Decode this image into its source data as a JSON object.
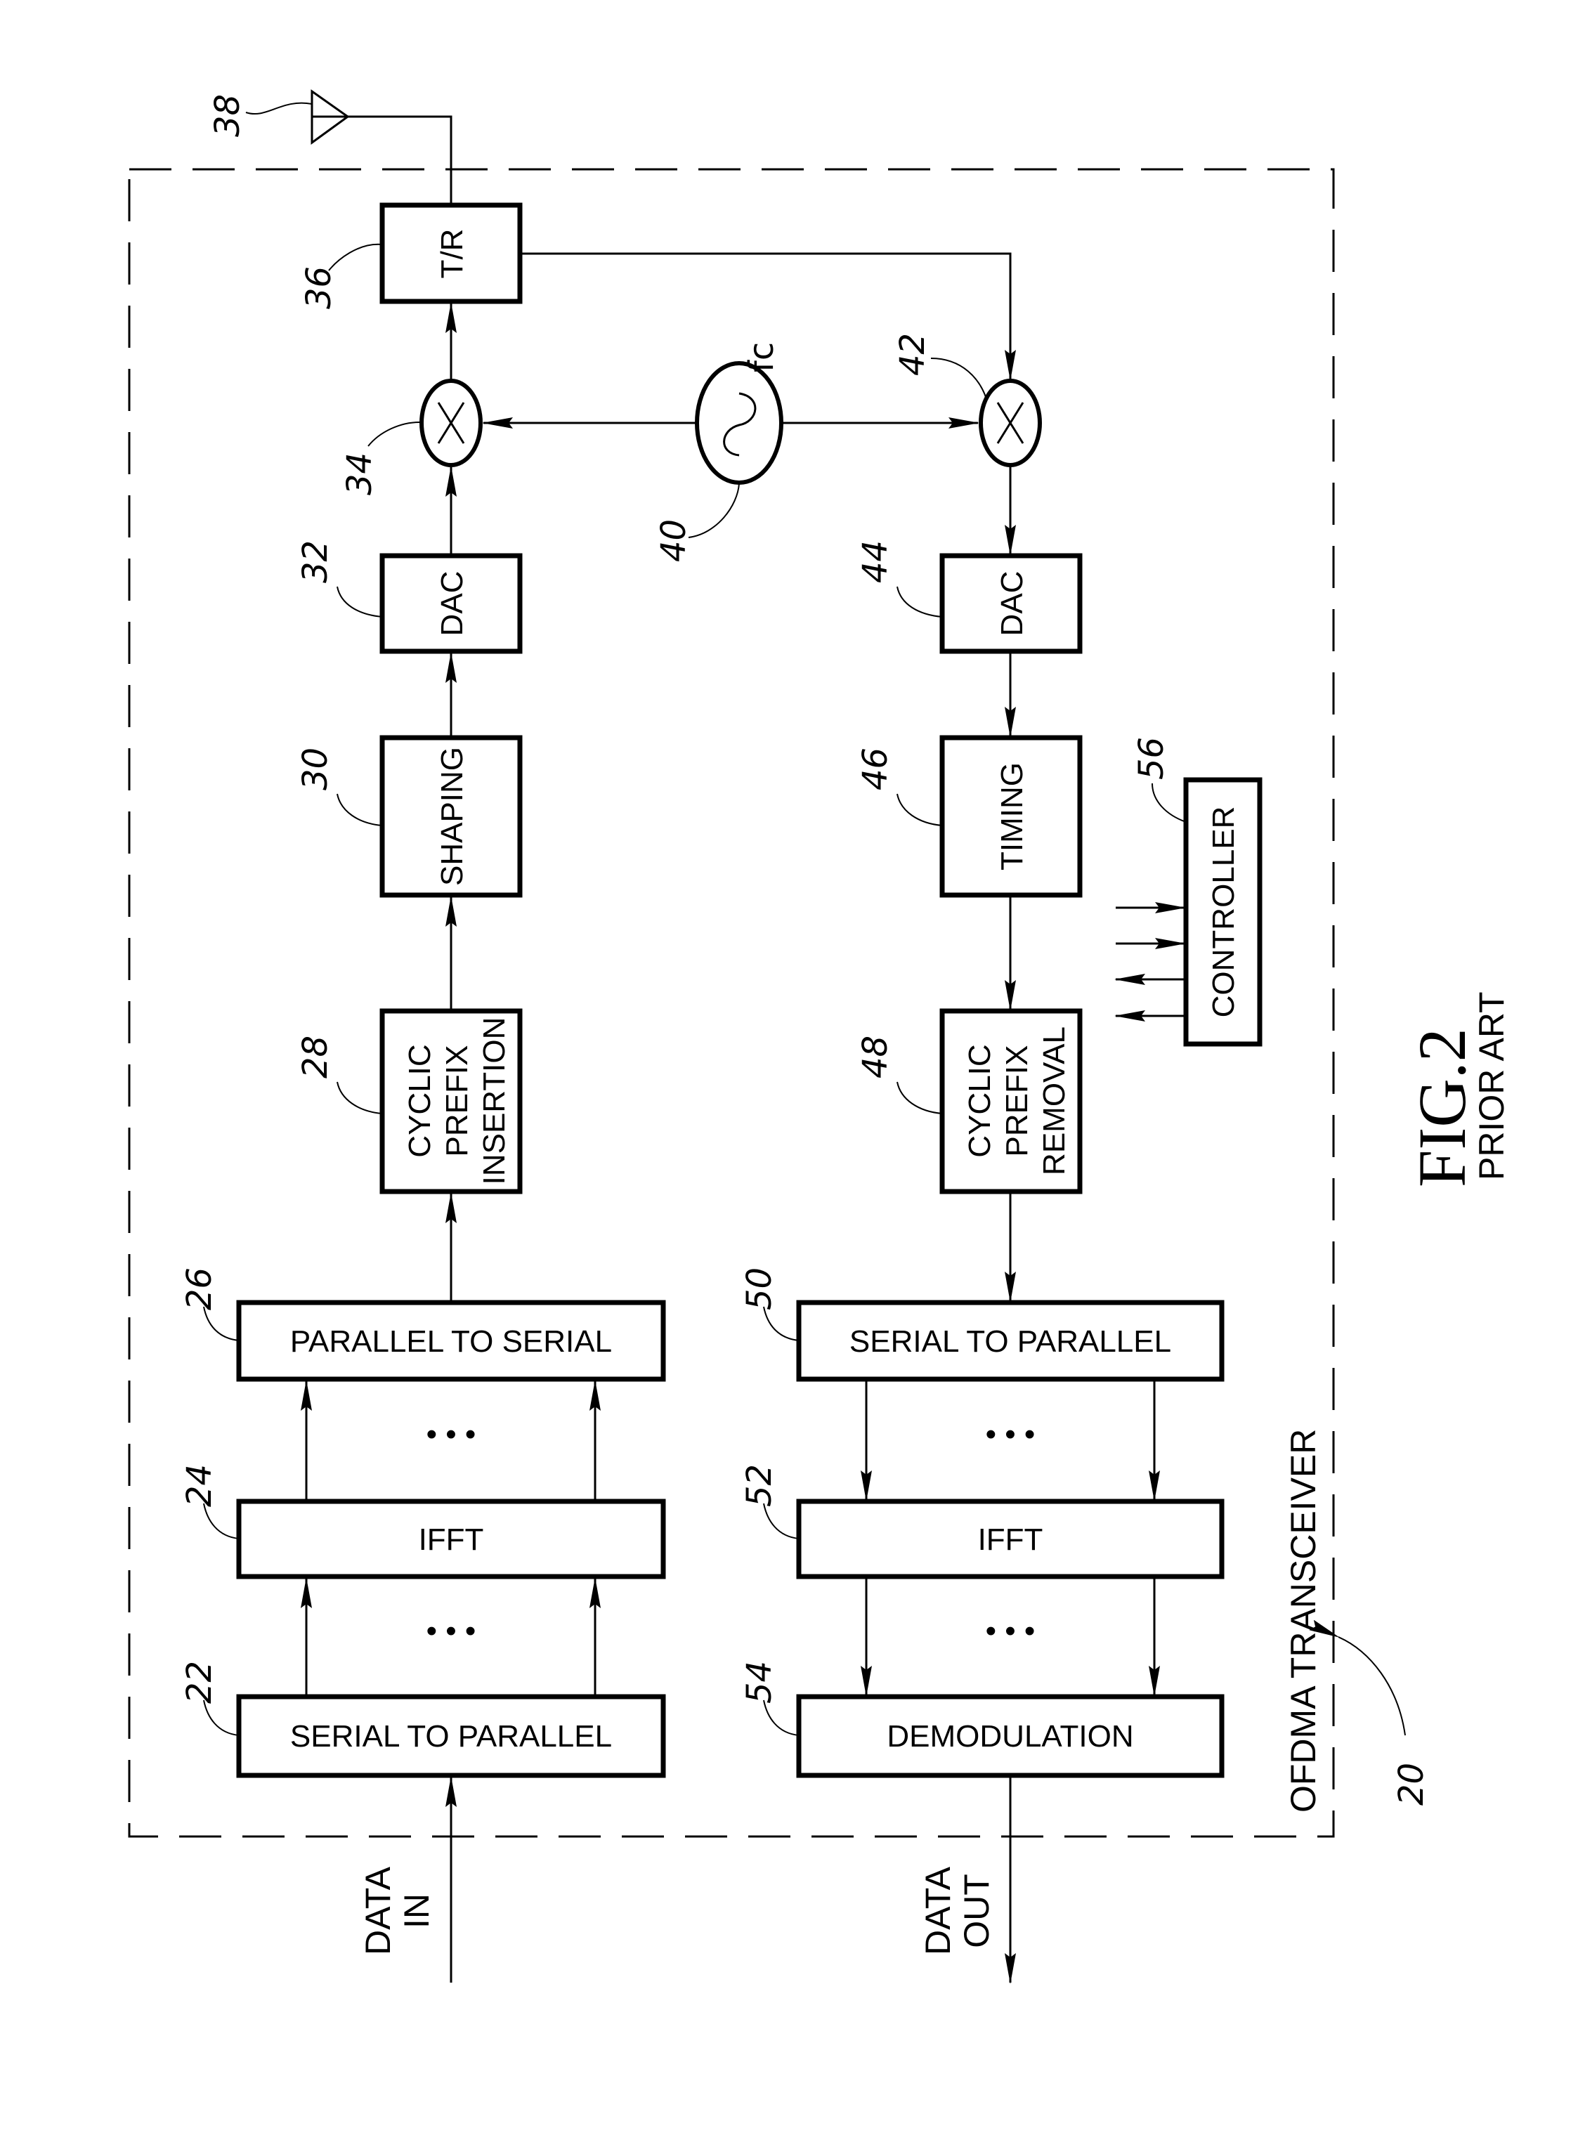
{
  "figure": {
    "title": "FIG.2",
    "subtitle": "PRIOR ART",
    "system_label": "OFDMA TRANSCEIVER",
    "system_ref": "20"
  },
  "transmit_chain": [
    {
      "ref": "22",
      "label": "SERIAL TO PARALLEL"
    },
    {
      "ref": "24",
      "label": "IFFT"
    },
    {
      "ref": "26",
      "label": "PARALLEL TO SERIAL"
    },
    {
      "ref": "28",
      "lines": [
        "CYCLIC",
        "PREFIX",
        "INSERTION"
      ]
    },
    {
      "ref": "30",
      "label": "SHAPING"
    },
    {
      "ref": "32",
      "label": "DAC"
    },
    {
      "ref": "34",
      "symbol": "mixer"
    },
    {
      "ref": "36",
      "label": "T/R"
    },
    {
      "ref": "38",
      "symbol": "antenna"
    }
  ],
  "oscillator": {
    "ref": "40",
    "label": "fc"
  },
  "receive_chain": [
    {
      "ref": "42",
      "symbol": "mixer"
    },
    {
      "ref": "44",
      "label": "DAC"
    },
    {
      "ref": "46",
      "label": "TIMING"
    },
    {
      "ref": "48",
      "lines": [
        "CYCLIC",
        "PREFIX",
        "REMOVAL"
      ]
    },
    {
      "ref": "50",
      "label": "SERIAL TO PARALLEL"
    },
    {
      "ref": "52",
      "label": "IFFT"
    },
    {
      "ref": "54",
      "label": "DEMODULATION"
    }
  ],
  "controller": {
    "ref": "56",
    "label": "CONTROLLER"
  },
  "io": {
    "data_in": [
      "DATA",
      "IN"
    ],
    "data_out": [
      "DATA",
      "OUT"
    ]
  },
  "ellipsis": "• • •"
}
